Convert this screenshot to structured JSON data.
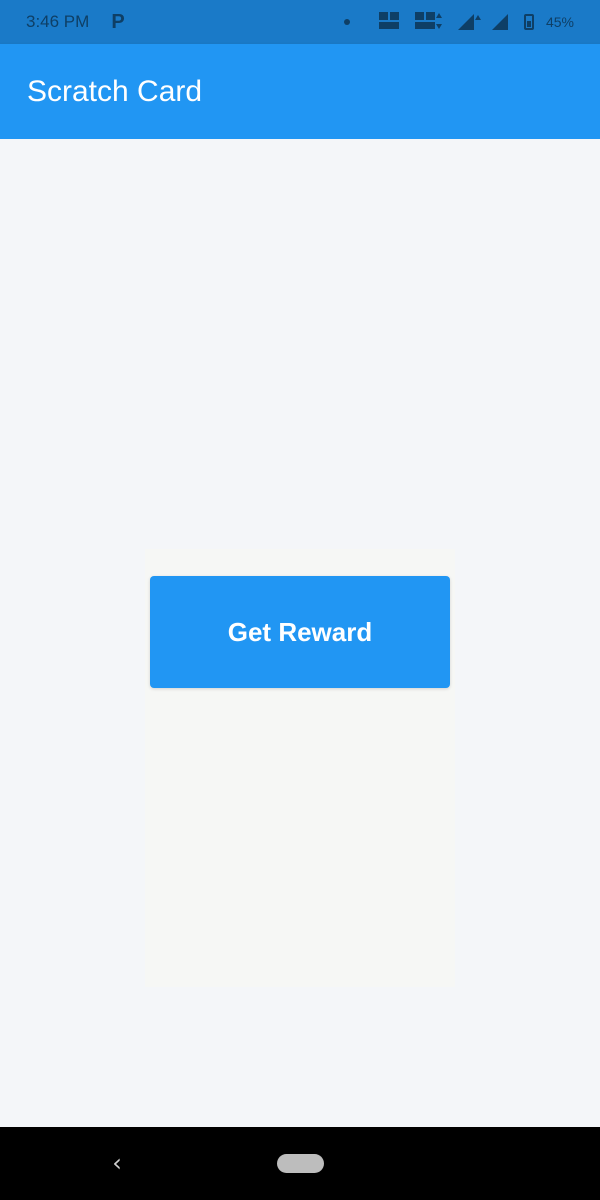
{
  "status_bar": {
    "time": "3:46 PM",
    "carrier_icon_label": "P",
    "battery": "45%",
    "icons": [
      "notification-dot-icon",
      "volte-icon",
      "volte-icon",
      "signal-icon",
      "signal-icon",
      "battery-icon"
    ]
  },
  "app_bar": {
    "title": "Scratch Card",
    "color": "#2196f3"
  },
  "main": {
    "reward_button_label": "Get Reward",
    "button_color": "#2196f3"
  },
  "nav_bar": {
    "back_icon": "back-chevron-icon",
    "home_icon": "home-pill-icon"
  }
}
